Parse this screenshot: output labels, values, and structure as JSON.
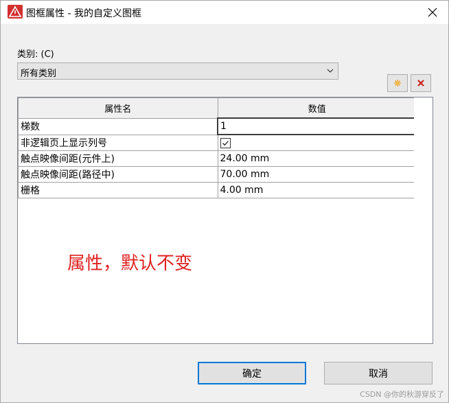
{
  "window": {
    "title": "图框属性 - 我的自定义图框"
  },
  "category": {
    "label": "类别: (C)",
    "selected": "所有类别"
  },
  "grid": {
    "headers": [
      "属性名",
      "数值"
    ],
    "rows": [
      {
        "name": "梯数",
        "value": "1"
      },
      {
        "name": "非逻辑页上显示列号",
        "value": "",
        "checked": true
      },
      {
        "name": "触点映像间距(元件上)",
        "value": "24.00 mm"
      },
      {
        "name": "触点映像间距(路径中)",
        "value": "70.00 mm"
      },
      {
        "name": "栅格",
        "value": "4.00 mm"
      }
    ]
  },
  "annotation": "属性，默认不变",
  "buttons": {
    "ok": "确定",
    "cancel": "取消"
  },
  "watermark": "CSDN @你的秋游穿反了",
  "colors": {
    "annotation": "#e02020",
    "app_icon": "#d32f2f",
    "default_button_border": "#0078d7"
  }
}
